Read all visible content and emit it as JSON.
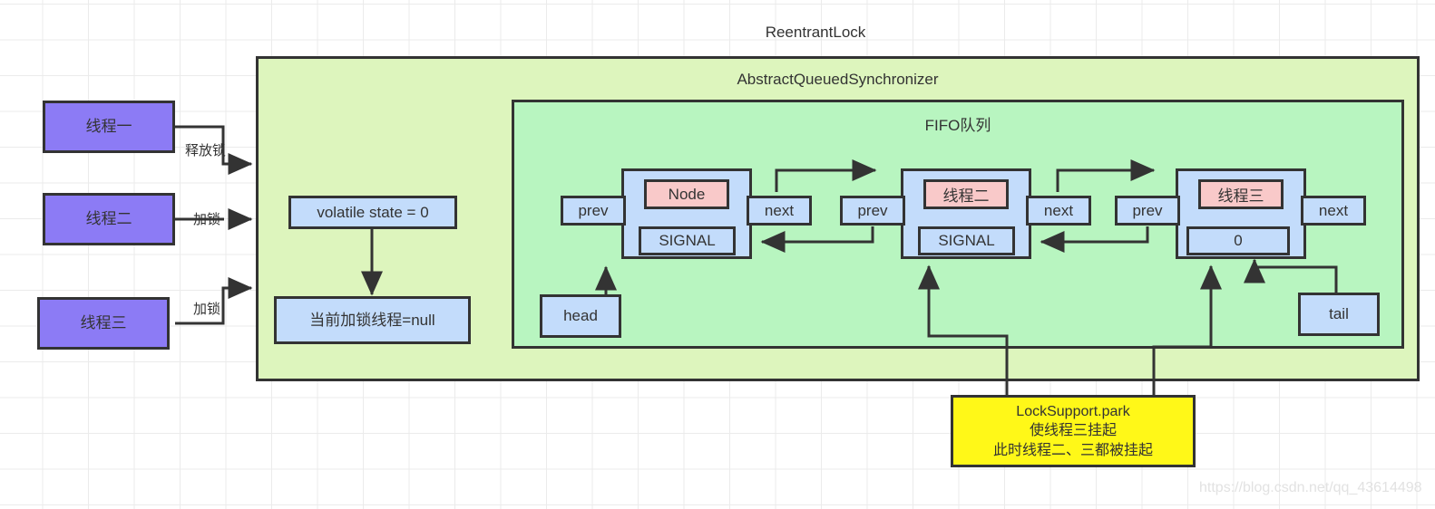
{
  "diagram": {
    "title": "ReentrantLock",
    "watermark": "https://blog.csdn.net/qq_43614498"
  },
  "containers": {
    "reentrant_lock": "ReentrantLock",
    "aqs": "AbstractQueuedSynchronizer",
    "fifo": "FIFO队列"
  },
  "threads": [
    {
      "label": "线程一",
      "edge_label": "释放锁"
    },
    {
      "label": "线程二",
      "edge_label": "加锁"
    },
    {
      "label": "线程三",
      "edge_label": "加锁"
    }
  ],
  "state": {
    "volatile_state": "volatile state = 0",
    "owner_thread": "当前加锁线程=null"
  },
  "queue": {
    "head_label": "head",
    "tail_label": "tail",
    "prev_label": "prev",
    "next_label": "next",
    "nodes": [
      {
        "name": "Node",
        "name_color": "pink",
        "status": "SIGNAL",
        "prev": "prev",
        "next": "next"
      },
      {
        "name": "线程二",
        "name_color": "pink",
        "status": "SIGNAL",
        "prev": "prev",
        "next": "next"
      },
      {
        "name": "线程三",
        "name_color": "pink",
        "status": "0",
        "prev": "prev",
        "next": "next"
      }
    ]
  },
  "note": {
    "line1": "LockSupport.park",
    "line2": "使线程三挂起",
    "line3": "此时线程二、三都被挂起"
  },
  "colors": {
    "thread_fill": "#8C7BF5",
    "blue_fill": "#c3dcfb",
    "pink_fill": "#f9c9c9",
    "aqs_fill": "#ddf5bd",
    "fifo_fill": "#b8f5c0",
    "note_fill": "#FFF818",
    "stroke": "#333333"
  }
}
